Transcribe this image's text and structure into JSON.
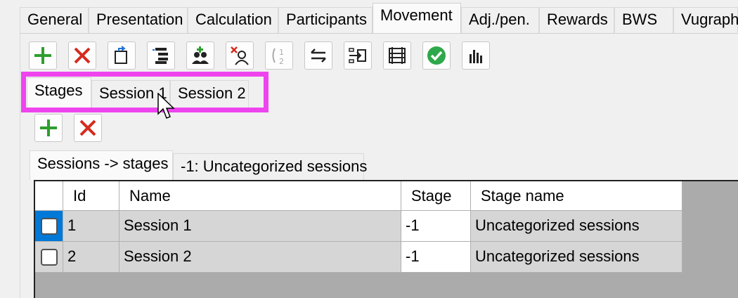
{
  "main_tabs": [
    {
      "label": "General",
      "active": false
    },
    {
      "label": "Presentation",
      "active": false
    },
    {
      "label": "Calculation",
      "active": false
    },
    {
      "label": "Participants",
      "active": false
    },
    {
      "label": "Movement",
      "active": true
    },
    {
      "label": "Adj./pen.",
      "active": false
    },
    {
      "label": "Rewards",
      "active": false
    },
    {
      "label": "BWS",
      "active": false
    },
    {
      "label": "Vugraph",
      "active": false
    }
  ],
  "toolbar_icons": [
    "add-icon",
    "delete-icon",
    "copy-icon",
    "tree-icon",
    "group-icon",
    "remove-user-icon",
    "swap-numbers-icon",
    "exchange-icon",
    "move-in-icon",
    "table-rows-icon",
    "check-icon",
    "chart-icon"
  ],
  "sub_tabs": [
    {
      "label": "Stages",
      "active": true
    },
    {
      "label": "Session 1",
      "active": false
    },
    {
      "label": "Session 2",
      "active": false
    }
  ],
  "sub_toolbar_icons": [
    "add-icon",
    "delete-icon"
  ],
  "grid_tabs": [
    {
      "label": "Sessions -> stages",
      "active": true
    },
    {
      "label": "-1: Uncategorized sessions",
      "active": false
    }
  ],
  "grid": {
    "columns": [
      "Id",
      "Name",
      "Stage",
      "Stage name"
    ],
    "rows": [
      {
        "id": "1",
        "name": "Session 1",
        "stage": "-1",
        "stage_name": "Uncategorized sessions",
        "selected": true
      },
      {
        "id": "2",
        "name": "Session 2",
        "stage": "-1",
        "stage_name": "Uncategorized sessions",
        "selected": false
      }
    ]
  },
  "colors": {
    "highlight": "#ee44ee",
    "add": "#2e9e2e",
    "delete": "#d42b1e",
    "check": "#2ea84a",
    "selection": "#0078d7"
  }
}
